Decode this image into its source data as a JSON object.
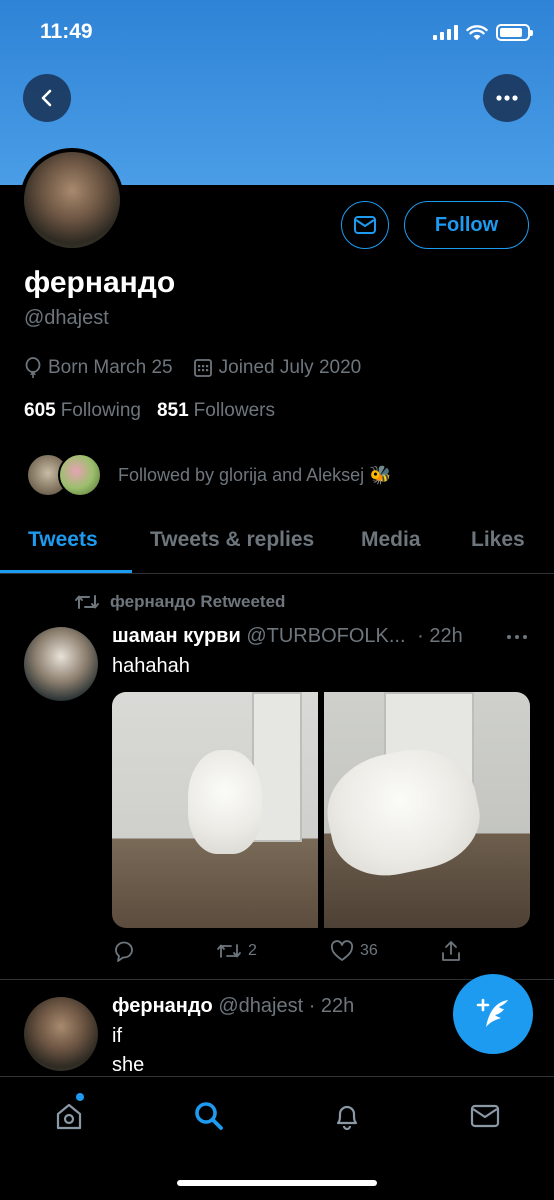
{
  "status_bar": {
    "time": "11:49",
    "battery_level": 0.85
  },
  "profile": {
    "name": "фернандо",
    "handle": "@dhajest",
    "born": "Born March 25",
    "joined": "Joined July 2020",
    "following_count": "605",
    "following_label": "Following",
    "followers_count": "851",
    "followers_label": "Followers",
    "followed_by": "Followed by glorija and Aleksej 🐝",
    "follow_button": "Follow"
  },
  "tabs": [
    {
      "label": "Tweets",
      "active": true
    },
    {
      "label": "Tweets & replies",
      "active": false
    },
    {
      "label": "Media",
      "active": false
    },
    {
      "label": "Likes",
      "active": false
    }
  ],
  "tweets": [
    {
      "retweet_note": "фернандо Retweeted",
      "name": "шаман курви",
      "handle": "@TURBOFOLK...",
      "time": "· 22h",
      "text": "hahahah",
      "retweets": "2",
      "likes": "36"
    },
    {
      "name": "фернандо",
      "handle": "@dhajest",
      "time": "· 22h",
      "text_line1": "if",
      "text_line2": "she"
    }
  ],
  "icons": {
    "back": "chevron-left-icon",
    "more": "more-horizontal-icon",
    "message": "envelope-icon",
    "birthday": "balloon-icon",
    "calendar": "calendar-icon",
    "retweet": "retweet-icon",
    "reply": "reply-icon",
    "like": "heart-icon",
    "share": "share-icon",
    "compose": "compose-tweet-icon",
    "home": "home-icon",
    "search": "search-icon",
    "notifications": "bell-icon",
    "messages": "mail-icon"
  },
  "colors": {
    "accent": "#1d9bf0",
    "banner": "#3b91de",
    "muted": "#6e767d",
    "background": "#000000"
  }
}
